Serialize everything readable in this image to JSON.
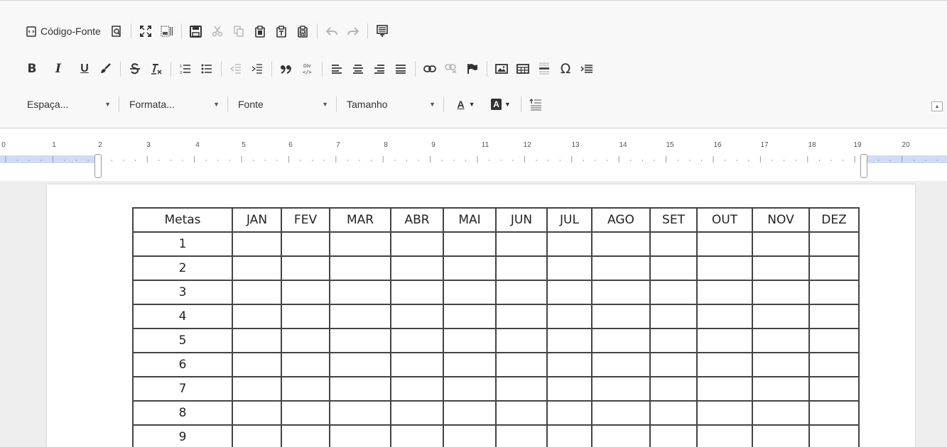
{
  "toolbar": {
    "source_label": "Código-Fonte",
    "combos": [
      {
        "label": "Espaça...",
        "name": "spacing"
      },
      {
        "label": "Formata...",
        "name": "format"
      },
      {
        "label": "Fonte",
        "name": "font"
      },
      {
        "label": "Tamanho",
        "name": "size"
      }
    ],
    "bold": "B",
    "italic": "I",
    "underline": "U",
    "font_color_label": "A",
    "bg_color_label": "A",
    "omega": "Ω"
  },
  "ruler": {
    "numbers": [
      "0",
      "1",
      "2",
      "3",
      "4",
      "5",
      "6",
      "7",
      "8",
      "9",
      "11",
      "12",
      "13",
      "14",
      "15",
      "16",
      "17",
      "18",
      "19",
      "20"
    ]
  },
  "table": {
    "header": [
      "Metas",
      "JAN",
      "FEV",
      "MAR",
      "ABR",
      "MAI",
      "JUN",
      "JUL",
      "AGO",
      "SET",
      "OUT",
      "NOV",
      "DEZ"
    ],
    "rows": [
      "1",
      "2",
      "3",
      "4",
      "5",
      "6",
      "7",
      "8",
      "9"
    ]
  }
}
